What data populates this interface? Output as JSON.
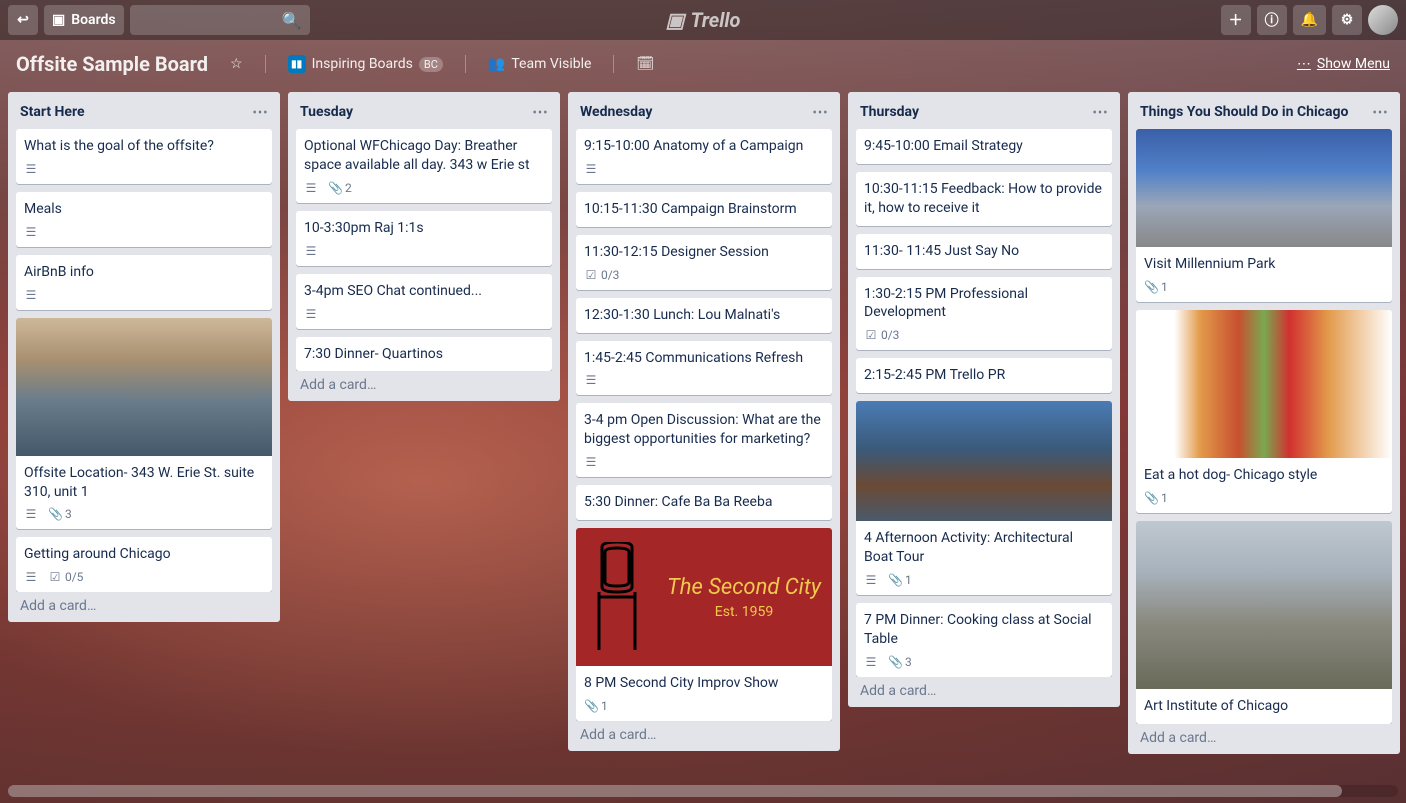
{
  "header": {
    "boards": "Boards",
    "logo": "Trello"
  },
  "boardHeader": {
    "title": "Offsite Sample Board",
    "team": "Inspiring Boards",
    "bc": "BC",
    "visibility": "Team Visible",
    "showMenu": "Show Menu"
  },
  "lists": [
    {
      "name": "Start Here",
      "cards": [
        {
          "title": "What is the goal of the offsite?",
          "desc": true
        },
        {
          "title": "Meals",
          "desc": true
        },
        {
          "title": "AirBnB info",
          "desc": true
        },
        {
          "title": "Offsite Location- 343 W. Erie St. suite 310, unit 1",
          "desc": true,
          "attach": "3",
          "cover": "office"
        },
        {
          "title": "Getting around Chicago",
          "desc": true,
          "check": "0/5"
        }
      ]
    },
    {
      "name": "Tuesday",
      "cards": [
        {
          "title": "Optional WFChicago Day: Breather space available all day. 343 w Erie st",
          "desc": true,
          "attach": "2"
        },
        {
          "title": "10-3:30pm Raj 1:1s",
          "desc": true
        },
        {
          "title": "3-4pm SEO Chat continued...",
          "desc": true
        },
        {
          "title": "7:30 Dinner- Quartinos"
        }
      ]
    },
    {
      "name": "Wednesday",
      "cards": [
        {
          "title": "9:15-10:00 Anatomy of a Campaign",
          "desc": true
        },
        {
          "title": "10:15-11:30 Campaign Brainstorm"
        },
        {
          "title": "11:30-12:15 Designer Session",
          "check": "0/3"
        },
        {
          "title": "12:30-1:30 Lunch: Lou Malnati's"
        },
        {
          "title": "1:45-2:45 Communications Refresh",
          "desc": true
        },
        {
          "title": "3-4 pm Open Discussion: What are the biggest opportunities for marketing?",
          "desc": true
        },
        {
          "title": "5:30 Dinner: Cafe Ba Ba Reeba"
        },
        {
          "title": "8 PM Second City Improv Show",
          "attach": "1",
          "cover": "sc"
        }
      ]
    },
    {
      "name": "Thursday",
      "cards": [
        {
          "title": "9:45-10:00 Email Strategy"
        },
        {
          "title": "10:30-11:15 Feedback: How to provide it, how to receive it"
        },
        {
          "title": "11:30- 11:45 Just Say No"
        },
        {
          "title": "1:30-2:15 PM Professional Development",
          "check": "0/3"
        },
        {
          "title": "2:15-2:45 PM Trello PR"
        },
        {
          "title": "4 Afternoon Activity: Architectural Boat Tour",
          "desc": true,
          "attach": "1",
          "cover": "chi",
          "coverH": 120
        },
        {
          "title": "7 PM Dinner: Cooking class at Social Table",
          "desc": true,
          "attach": "3"
        }
      ]
    },
    {
      "name": "Things You Should Do in Chicago",
      "cards": [
        {
          "title": "Visit Millennium Park",
          "attach": "1",
          "cover": "bean",
          "coverH": 118
        },
        {
          "title": "Eat a hot dog- Chicago style",
          "attach": "1",
          "cover": "dog",
          "coverH": 148
        },
        {
          "title": "Art Institute of Chicago",
          "cover": "art",
          "coverH": 168
        }
      ]
    }
  ],
  "addCard": "Add a card…",
  "secondCity": {
    "t1": "The Second City",
    "t2": "Est. 1959"
  }
}
